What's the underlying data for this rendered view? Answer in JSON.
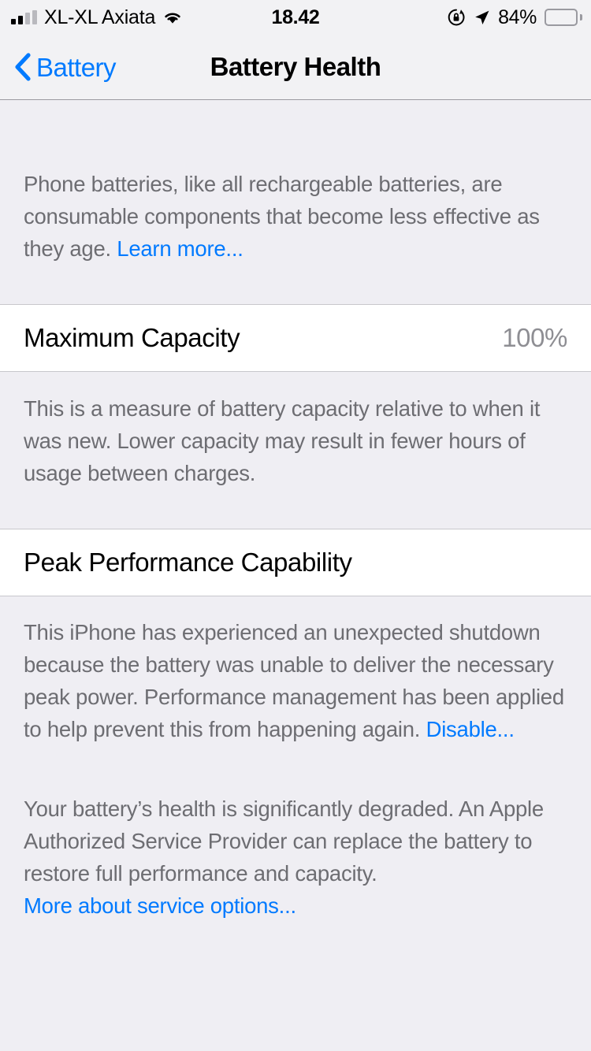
{
  "status_bar": {
    "carrier": "XL-XL Axiata",
    "time": "18.42",
    "battery_percent_label": "84%",
    "battery_level": 84,
    "signal_bars_filled": 2,
    "signal_bars_total": 4,
    "icons": {
      "wifi": "wifi-icon",
      "rotation_lock": "rotation-lock-icon",
      "location": "location-arrow-icon",
      "battery": "battery-icon"
    }
  },
  "nav": {
    "back_label": "Battery",
    "back_icon": "chevron-left-icon",
    "title": "Battery Health"
  },
  "content": {
    "intro": {
      "text": "Phone batteries, like all rechargeable batteries, are consumable components that become less effective as they age. ",
      "link": "Learn more..."
    },
    "maximum_capacity": {
      "label": "Maximum Capacity",
      "value": "100%",
      "description": "This is a measure of battery capacity relative to when it was new. Lower capacity may result in fewer hours of usage between charges."
    },
    "peak_performance": {
      "label": "Peak Performance Capability",
      "description": "This iPhone has experienced an unexpected shutdown because the battery was unable to deliver the necessary peak power. Performance management has been applied to help prevent this from happening again. ",
      "link": "Disable..."
    },
    "service": {
      "description": "Your battery’s health is significantly degraded. An Apple Authorized Service Provider can replace the battery to restore full performance and capacity.",
      "link": "More about service options..."
    }
  },
  "colors": {
    "accent_blue": "#007AFF",
    "page_background": "#EFEEF3",
    "cell_background": "#FFFFFF",
    "footer_text": "#6D6D72",
    "value_text": "#8E8E93"
  }
}
